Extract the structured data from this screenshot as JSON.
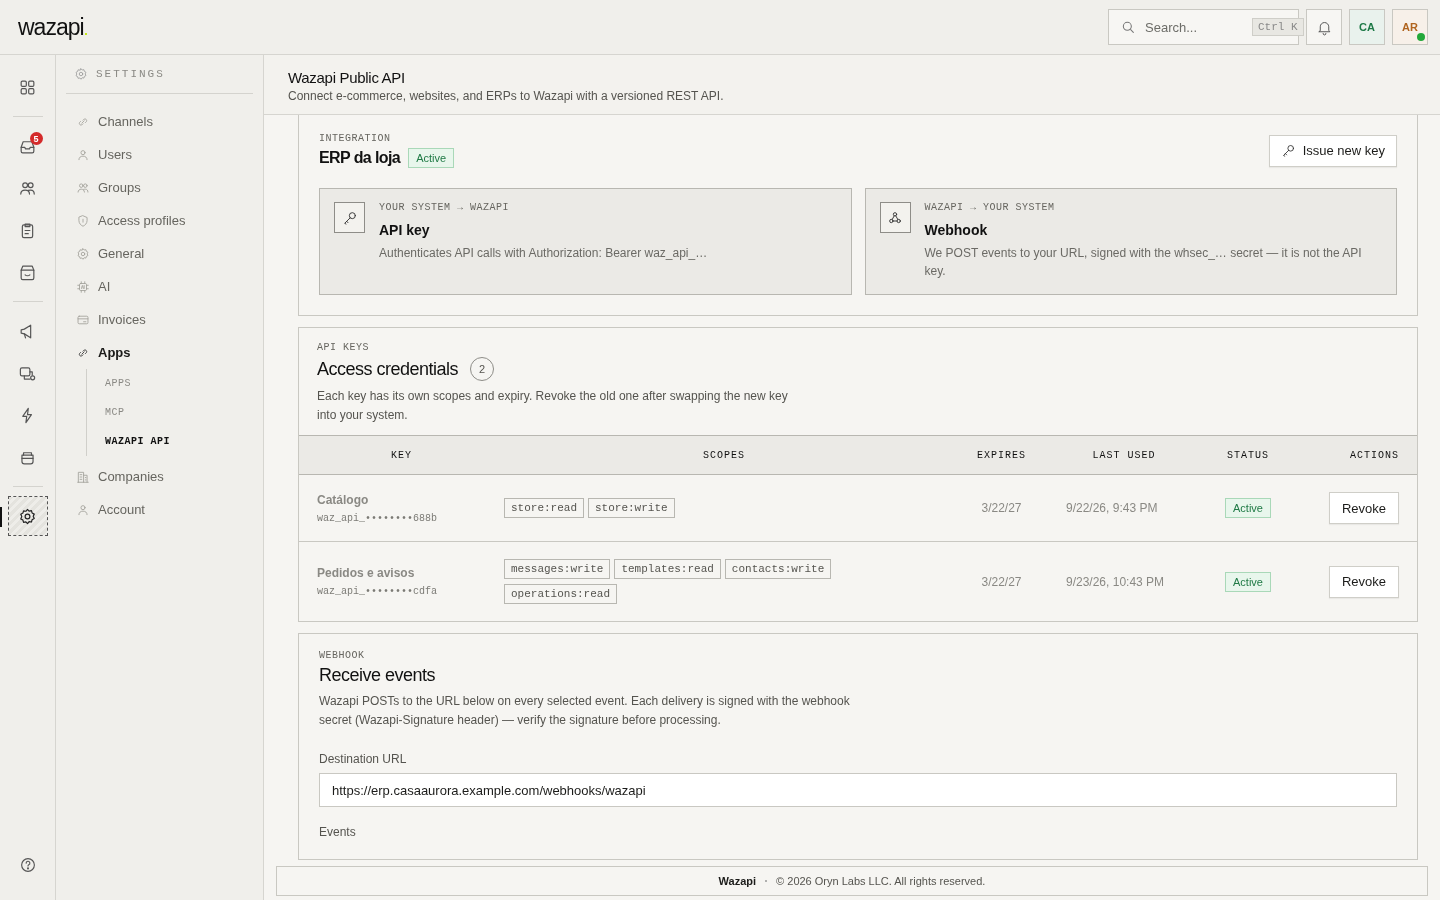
{
  "header": {
    "logo": "wazapi",
    "search": {
      "placeholder": "Search...",
      "shortcut": "Ctrl K"
    },
    "avatars": [
      {
        "initials": "CA",
        "color": "#1e7a47",
        "online": false
      },
      {
        "initials": "AR",
        "color": "#b0641f",
        "online": true
      }
    ]
  },
  "rail": {
    "items": [
      {
        "kind": "button",
        "selected": false
      },
      {
        "kind": "divider"
      },
      {
        "kind": "button",
        "selected": false,
        "badge": "5"
      },
      {
        "kind": "button",
        "selected": false
      },
      {
        "kind": "button",
        "selected": false
      },
      {
        "kind": "button",
        "selected": false
      },
      {
        "kind": "divider"
      },
      {
        "kind": "button",
        "selected": false
      },
      {
        "kind": "button",
        "selected": false
      },
      {
        "kind": "button",
        "selected": false
      },
      {
        "kind": "button",
        "selected": false
      },
      {
        "kind": "divider"
      },
      {
        "kind": "button",
        "selected": true
      }
    ]
  },
  "settings_nav": {
    "title": "SETTINGS",
    "items": [
      {
        "label": "Channels",
        "selected": false
      },
      {
        "label": "Users",
        "selected": false
      },
      {
        "label": "Groups",
        "selected": false
      },
      {
        "label": "Access profiles",
        "selected": false
      },
      {
        "label": "General",
        "selected": false
      },
      {
        "label": "AI",
        "selected": false
      },
      {
        "label": "Invoices",
        "selected": false
      },
      {
        "label": "Apps",
        "selected": true,
        "children": [
          {
            "label": "APPS",
            "selected": false
          },
          {
            "label": "MCP",
            "selected": false
          },
          {
            "label": "WAZAPI API",
            "selected": true
          }
        ]
      },
      {
        "label": "Companies",
        "selected": false
      },
      {
        "label": "Account",
        "selected": false
      }
    ]
  },
  "page": {
    "title": "Wazapi Public API",
    "subtitle": "Connect e-commerce, websites, and ERPs to Wazapi with a versioned REST API."
  },
  "integration": {
    "eyebrow": "INTEGRATION",
    "title": "ERP da loja",
    "status": "Active",
    "button": "Issue new key",
    "flows": [
      {
        "eyebrow": "YOUR SYSTEM → WAZAPI",
        "title": "API key",
        "description": "Authenticates API calls with Authorization: Bearer waz_api_…"
      },
      {
        "eyebrow": "WAZAPI → YOUR SYSTEM",
        "title": "Webhook",
        "description": "We POST events to your URL, signed with the whsec_… secret — it is not the API key."
      }
    ]
  },
  "keys": {
    "eyebrow": "API KEYS",
    "title": "Access credentials",
    "count": "2",
    "description": "Each key has its own scopes and expiry. Revoke the old one after swapping the new key into your system.",
    "columns": [
      "KEY",
      "SCOPES",
      "EXPIRES",
      "LAST USED",
      "STATUS",
      "ACTIONS"
    ],
    "rows": [
      {
        "name": "Catálogo",
        "key": "waz_api_••••••••688b",
        "scopes": [
          "store:read",
          "store:write"
        ],
        "expires": "3/22/27",
        "last_used": "9/22/26, 9:43 PM",
        "status": "Active",
        "action": "Revoke"
      },
      {
        "name": "Pedidos e avisos",
        "key": "waz_api_••••••••cdfa",
        "scopes": [
          "messages:write",
          "templates:read",
          "contacts:write",
          "operations:read"
        ],
        "expires": "3/22/27",
        "last_used": "9/23/26, 10:43 PM",
        "status": "Active",
        "action": "Revoke"
      }
    ]
  },
  "webhook": {
    "eyebrow": "WEBHOOK",
    "title": "Receive events",
    "description": "Wazapi POSTs to the URL below on every selected event. Each delivery is signed with the webhook secret (Wazapi-Signature header) — verify the signature before processing.",
    "url_label": "Destination URL",
    "url": "https://erp.casaaurora.example.com/webhooks/wazapi",
    "events_label": "Events"
  },
  "footer": {
    "brand": "Wazapi",
    "text": "© 2026 Oryn Labs LLC. All rights reserved."
  }
}
